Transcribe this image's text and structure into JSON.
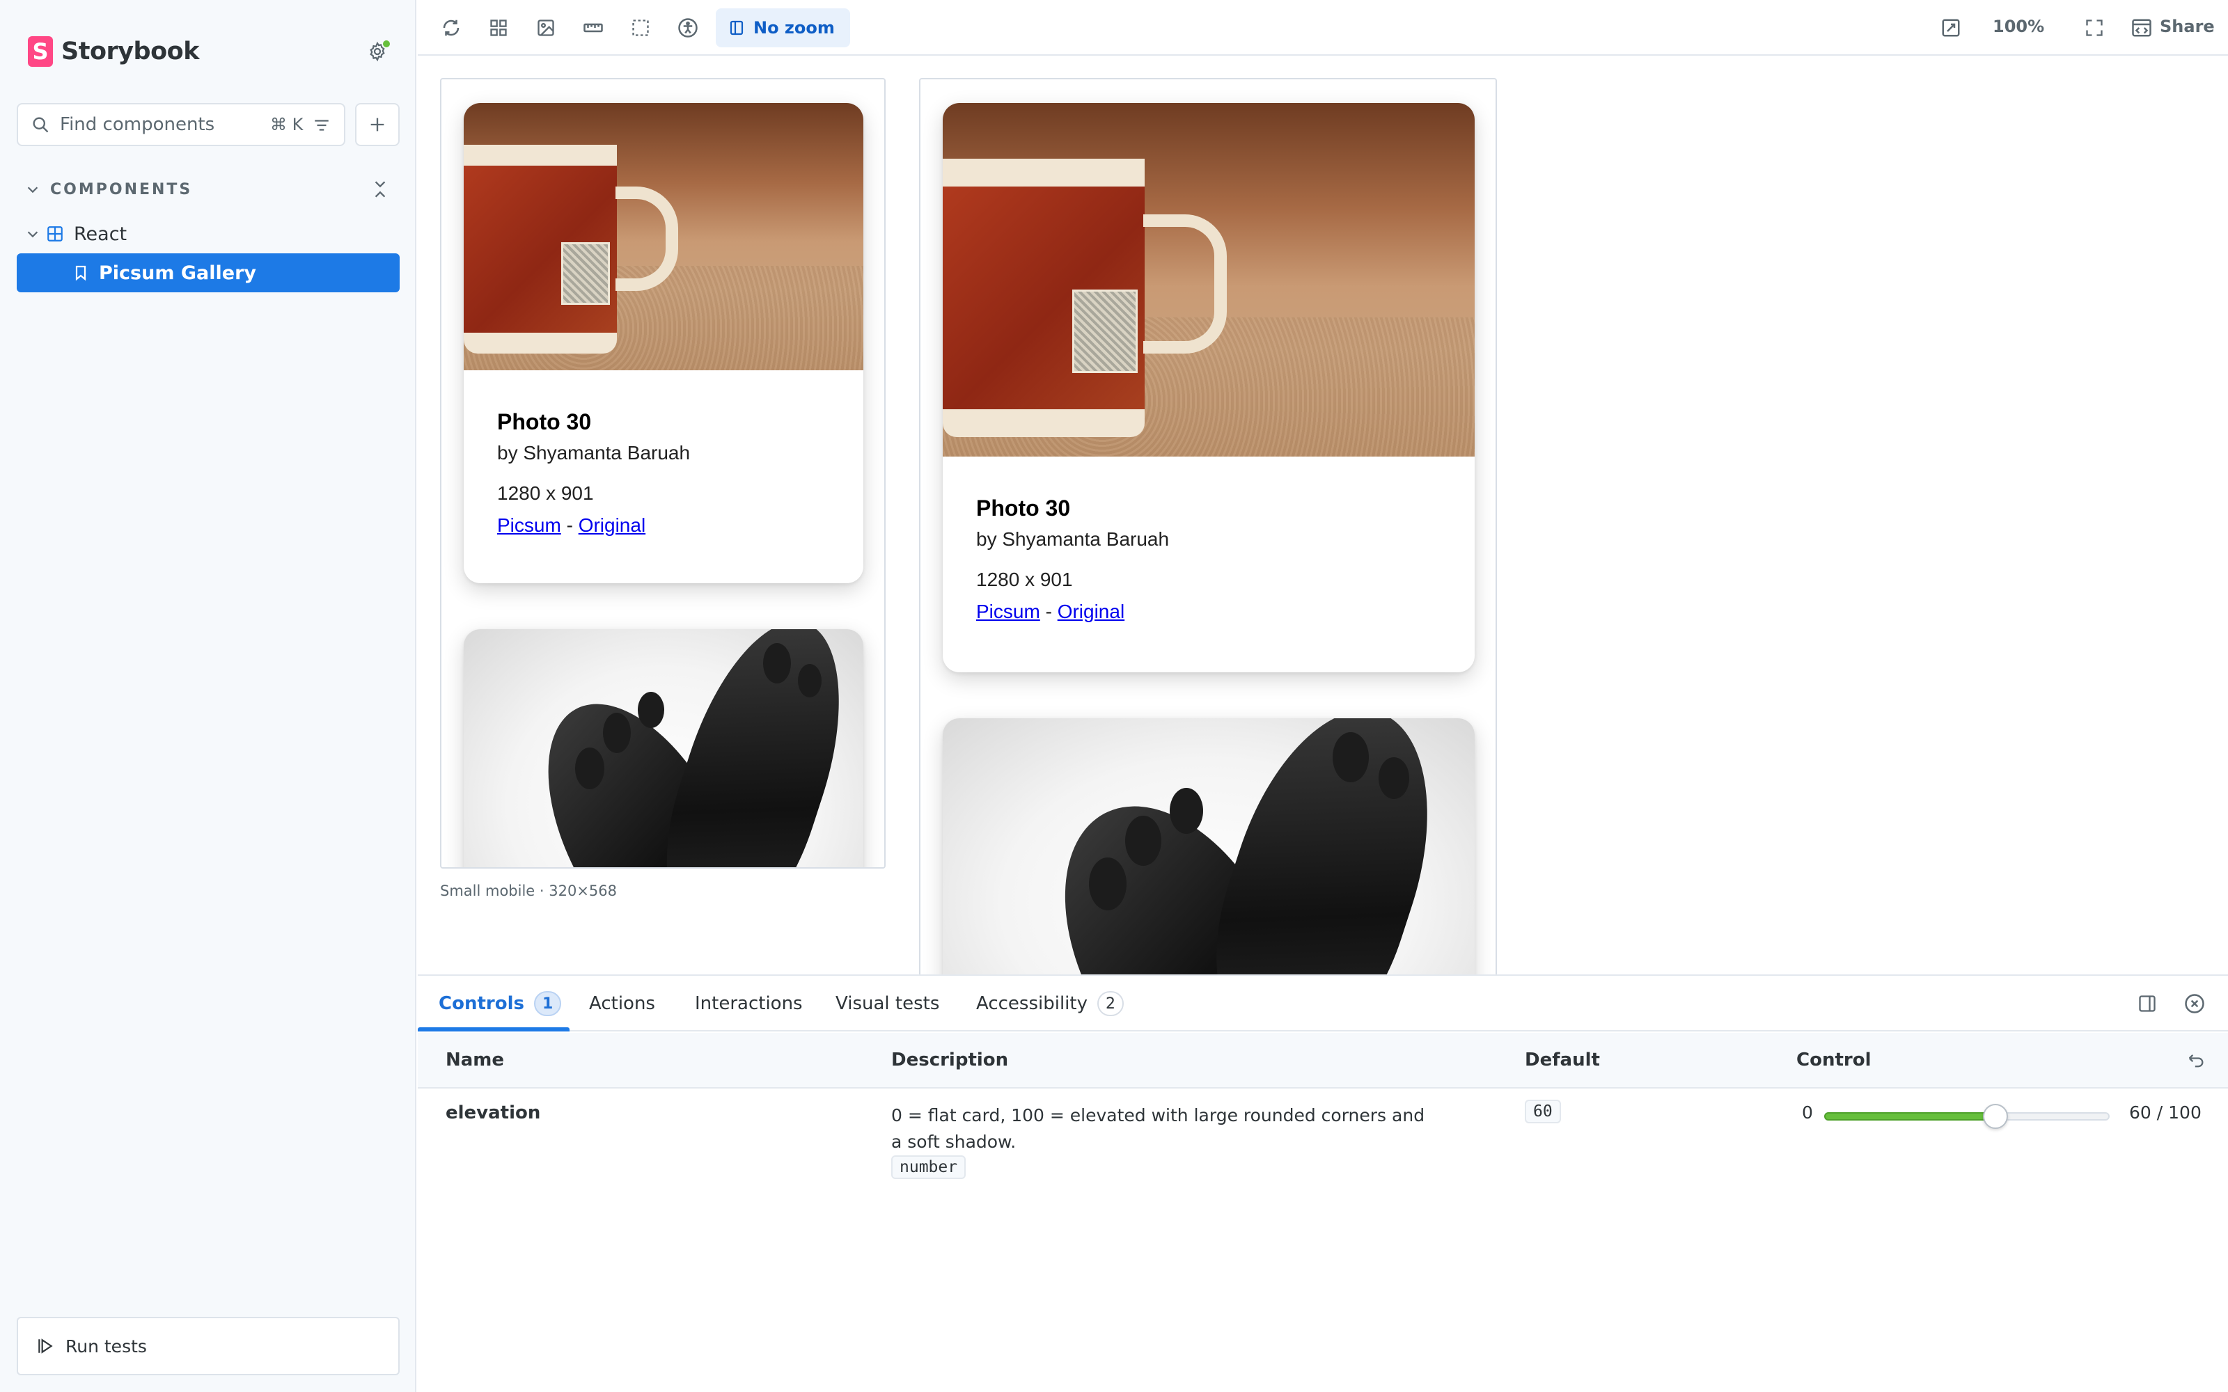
{
  "app": {
    "brand": "Storybook"
  },
  "sidebar": {
    "search_placeholder": "Find components",
    "search_shortcut": "⌘ K",
    "section_title": "COMPONENTS",
    "group_label": "React",
    "active_story": "Picsum Gallery",
    "run_tests_label": "Run tests"
  },
  "toolbar": {
    "zoom_label": "No zoom",
    "zoom_percent": "100%",
    "share_label": "Share"
  },
  "canvas": {
    "viewport_caption": "Small mobile · 320×568",
    "card": {
      "title": "Photo 30",
      "author": "by Shyamanta Baruah",
      "dimensions": "1280 x 901",
      "link_picsum": "Picsum",
      "link_separator": "-",
      "link_original": "Original"
    }
  },
  "panel": {
    "tabs": [
      {
        "label": "Controls",
        "badge": "1"
      },
      {
        "label": "Actions"
      },
      {
        "label": "Interactions"
      },
      {
        "label": "Visual tests"
      },
      {
        "label": "Accessibility",
        "badge": "2"
      }
    ],
    "columns": {
      "name": "Name",
      "description": "Description",
      "default": "Default",
      "control": "Control"
    },
    "rows": [
      {
        "name": "elevation",
        "description": "0 = flat card, 100 = elevated with large rounded corners and a soft shadow.",
        "type": "number",
        "default": "60",
        "range_min": "0",
        "range_value_text": "60 / 100",
        "value_fraction": 0.6
      }
    ]
  },
  "colors": {
    "accent": "#1d7ae6",
    "brand": "#ff4785",
    "status_ok": "#66bf3c",
    "link": "#0000ee"
  }
}
